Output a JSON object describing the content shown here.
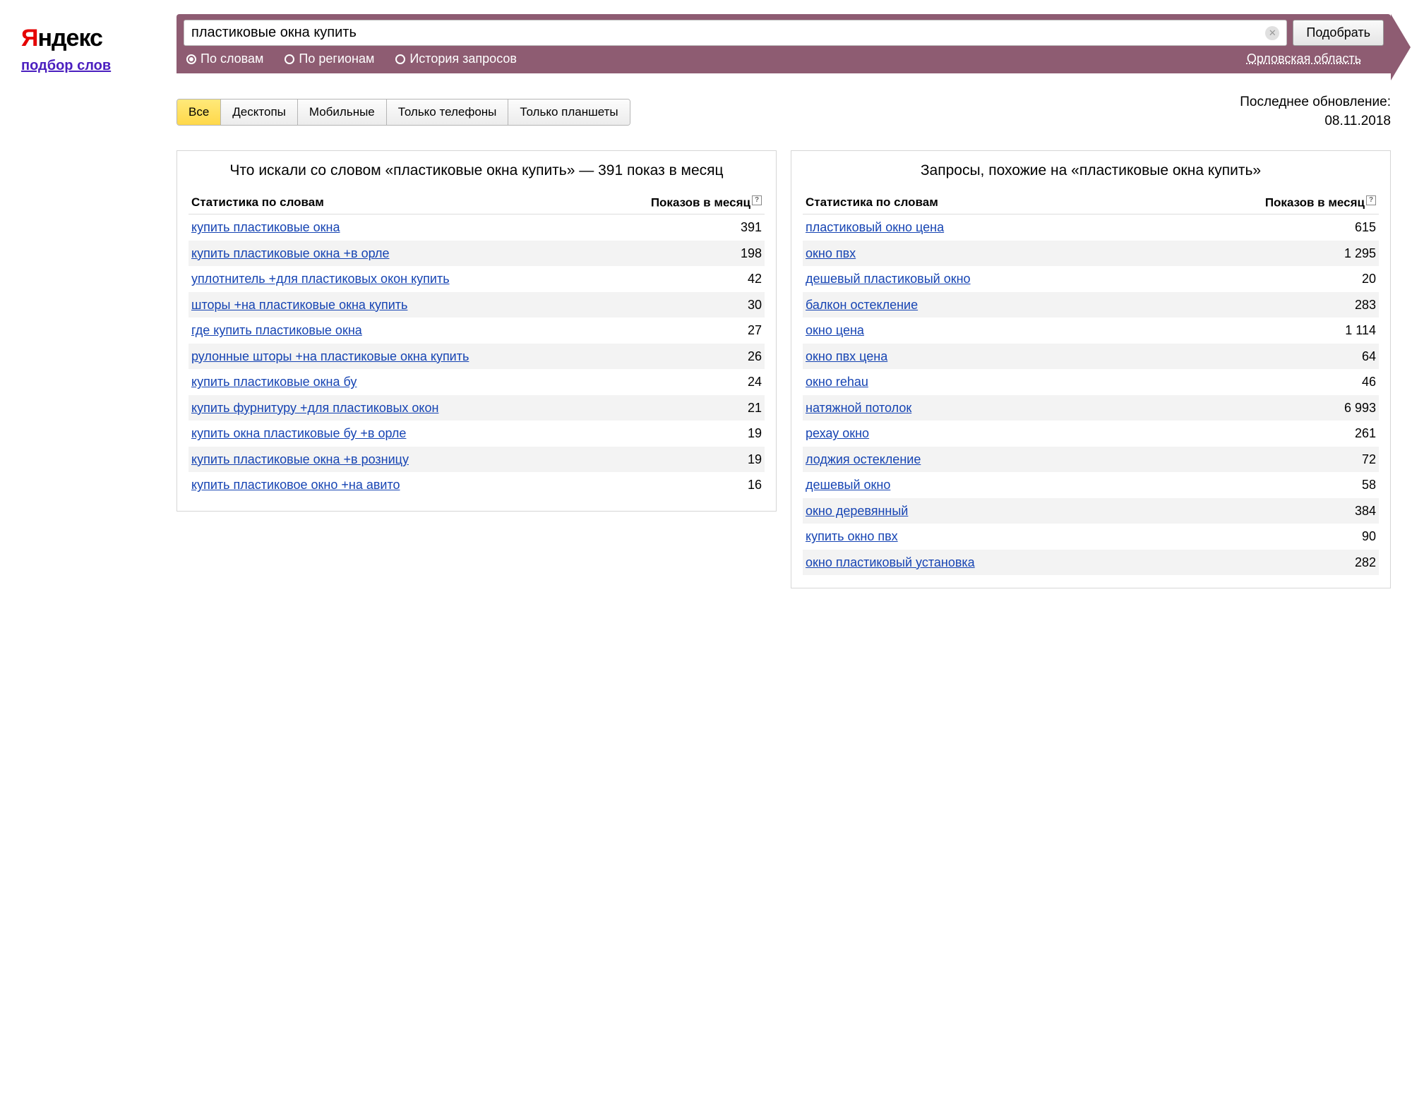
{
  "logo": {
    "red": "Я",
    "rest": "ндекс"
  },
  "service_link": "подбор слов",
  "search": {
    "value": "пластиковые окна купить",
    "submit": "Подобрать"
  },
  "mode_tabs": [
    {
      "label": "По словам",
      "selected": true
    },
    {
      "label": "По регионам",
      "selected": false
    },
    {
      "label": "История запросов",
      "selected": false
    }
  ],
  "region": "Орловская область",
  "device_tabs": [
    {
      "label": "Все",
      "active": true
    },
    {
      "label": "Десктопы",
      "active": false
    },
    {
      "label": "Мобильные",
      "active": false
    },
    {
      "label": "Только телефоны",
      "active": false
    },
    {
      "label": "Только планшеты",
      "active": false
    }
  ],
  "update": {
    "label": "Последнее обновление:",
    "date": "08.11.2018"
  },
  "columns": {
    "stat": "Статистика по словам",
    "shows": "Показов в месяц"
  },
  "left_panel": {
    "title": "Что искали со словом «пластиковые окна купить» — 391 показ в месяц",
    "rows": [
      {
        "kw": "купить пластиковые окна",
        "shows": "391"
      },
      {
        "kw": "купить пластиковые окна +в орле",
        "shows": "198"
      },
      {
        "kw": "уплотнитель +для пластиковых окон купить",
        "shows": "42"
      },
      {
        "kw": "шторы +на пластиковые окна купить",
        "shows": "30"
      },
      {
        "kw": "где купить пластиковые окна",
        "shows": "27"
      },
      {
        "kw": "рулонные шторы +на пластиковые окна купить",
        "shows": "26"
      },
      {
        "kw": "купить пластиковые окна бу",
        "shows": "24"
      },
      {
        "kw": "купить фурнитуру +для пластиковых окон",
        "shows": "21"
      },
      {
        "kw": "купить окна пластиковые бу +в орле",
        "shows": "19"
      },
      {
        "kw": "купить пластиковые окна +в розницу",
        "shows": "19"
      },
      {
        "kw": "купить пластиковое окно +на авито",
        "shows": "16"
      }
    ]
  },
  "right_panel": {
    "title": "Запросы, похожие на «пластиковые окна купить»",
    "rows": [
      {
        "kw": "пластиковый окно цена",
        "shows": "615"
      },
      {
        "kw": "окно пвх",
        "shows": "1 295"
      },
      {
        "kw": "дешевый пластиковый окно",
        "shows": "20"
      },
      {
        "kw": "балкон остекление",
        "shows": "283"
      },
      {
        "kw": "окно цена",
        "shows": "1 114"
      },
      {
        "kw": "окно пвх цена",
        "shows": "64"
      },
      {
        "kw": "окно rehau",
        "shows": "46"
      },
      {
        "kw": "натяжной потолок",
        "shows": "6 993"
      },
      {
        "kw": "рехау окно",
        "shows": "261"
      },
      {
        "kw": "лоджия остекление",
        "shows": "72"
      },
      {
        "kw": "дешевый окно",
        "shows": "58"
      },
      {
        "kw": "окно деревянный",
        "shows": "384"
      },
      {
        "kw": "купить окно пвх",
        "shows": "90"
      },
      {
        "kw": "окно пластиковый установка",
        "shows": "282"
      }
    ]
  }
}
